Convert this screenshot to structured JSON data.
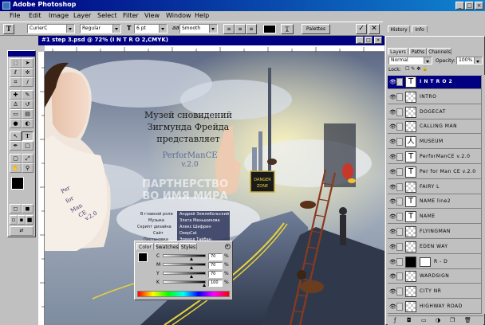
{
  "app": {
    "title": "Adobe Photoshop"
  },
  "menu": [
    "File",
    "Edit",
    "Image",
    "Layer",
    "Select",
    "Filter",
    "View",
    "Window",
    "Help"
  ],
  "options": {
    "tool_glyph": "T",
    "font_family": "CurierC",
    "font_style": "Regular",
    "size_icon": "T",
    "font_size": "6 pt",
    "aa_label": "aa",
    "aa_value": "Smooth",
    "palettes_label": "Palettes"
  },
  "document": {
    "title": "#1 step 3.psd @ 72% (I N T R O 2,CMYK)",
    "artwork": {
      "title_lines": [
        "Музей сновидений",
        "Зигмунда Фрейда",
        "представляет"
      ],
      "product": "PerforManCE",
      "version": "v.2.0",
      "watermark_lines": [
        "ПАРТНЕРСТВО",
        "ВО ИМЯ МИРА"
      ],
      "hand_text": [
        "Per",
        "for",
        "Man",
        "CE",
        "v.2.0"
      ],
      "credits_left": [
        "В главной роли",
        "Музыка",
        "Скрипт дизайна",
        "Сайт",
        "Постановка"
      ],
      "credits_right": [
        "Андрей Землебольский",
        "Злата Меньшикова",
        "Алекс Шифрин",
        "DeepCat",
        "Эдвард Тайбан"
      ],
      "sign_text": [
        "DANGER",
        "ZONE"
      ]
    }
  },
  "color_panel": {
    "tabs": [
      "Color",
      "Swatches",
      "Styles"
    ],
    "active_tab": "Color",
    "channels": [
      {
        "label": "C",
        "value": "70",
        "pct": 0.7
      },
      {
        "label": "M",
        "value": "70",
        "pct": 0.7
      },
      {
        "label": "Y",
        "value": "70",
        "pct": 0.7
      },
      {
        "label": "K",
        "value": "100",
        "pct": 1.0
      }
    ],
    "pct_sign": "%"
  },
  "right_tabs": {
    "history": "History",
    "info": "Info"
  },
  "layers_panel": {
    "tabs": [
      "Layers",
      "Paths",
      "Channels"
    ],
    "active_tab": "Layers",
    "blend_mode": "Normal",
    "opacity_label": "Opacity:",
    "opacity_value": "100%",
    "lock_label": "Lock:",
    "layers": [
      {
        "name": "I N T R O 2",
        "type": "text",
        "selected": true
      },
      {
        "name": "INTRO",
        "type": "raster",
        "selected": false
      },
      {
        "name": "DOGECAT",
        "type": "raster",
        "selected": false
      },
      {
        "name": "CALLING MAN",
        "type": "raster",
        "selected": false
      },
      {
        "name": "MUSEUM",
        "type": "text-alt",
        "selected": false
      },
      {
        "name": "PerforManCE v.2.0",
        "type": "text",
        "selected": false
      },
      {
        "name": "Per for Man CE v.2.0",
        "type": "text",
        "selected": false
      },
      {
        "name": "FAIRY L",
        "type": "raster",
        "selected": false
      },
      {
        "name": "NAME line2",
        "type": "text",
        "selected": false
      },
      {
        "name": "NAME",
        "type": "text",
        "selected": false
      },
      {
        "name": "FLYINGMAN",
        "type": "raster",
        "selected": false
      },
      {
        "name": "EDEN WAY",
        "type": "raster",
        "selected": false
      },
      {
        "name": "R - D",
        "type": "mask",
        "selected": false
      },
      {
        "name": "WARDSIGN",
        "type": "raster",
        "selected": false
      },
      {
        "name": "CITY NR",
        "type": "raster",
        "selected": false
      },
      {
        "name": "HIGHWAY ROAD",
        "type": "raster",
        "selected": false
      }
    ]
  },
  "colors": {
    "accent_title": "#000080",
    "ui_face": "#c0c0c0",
    "selected_layer": "#000080"
  }
}
